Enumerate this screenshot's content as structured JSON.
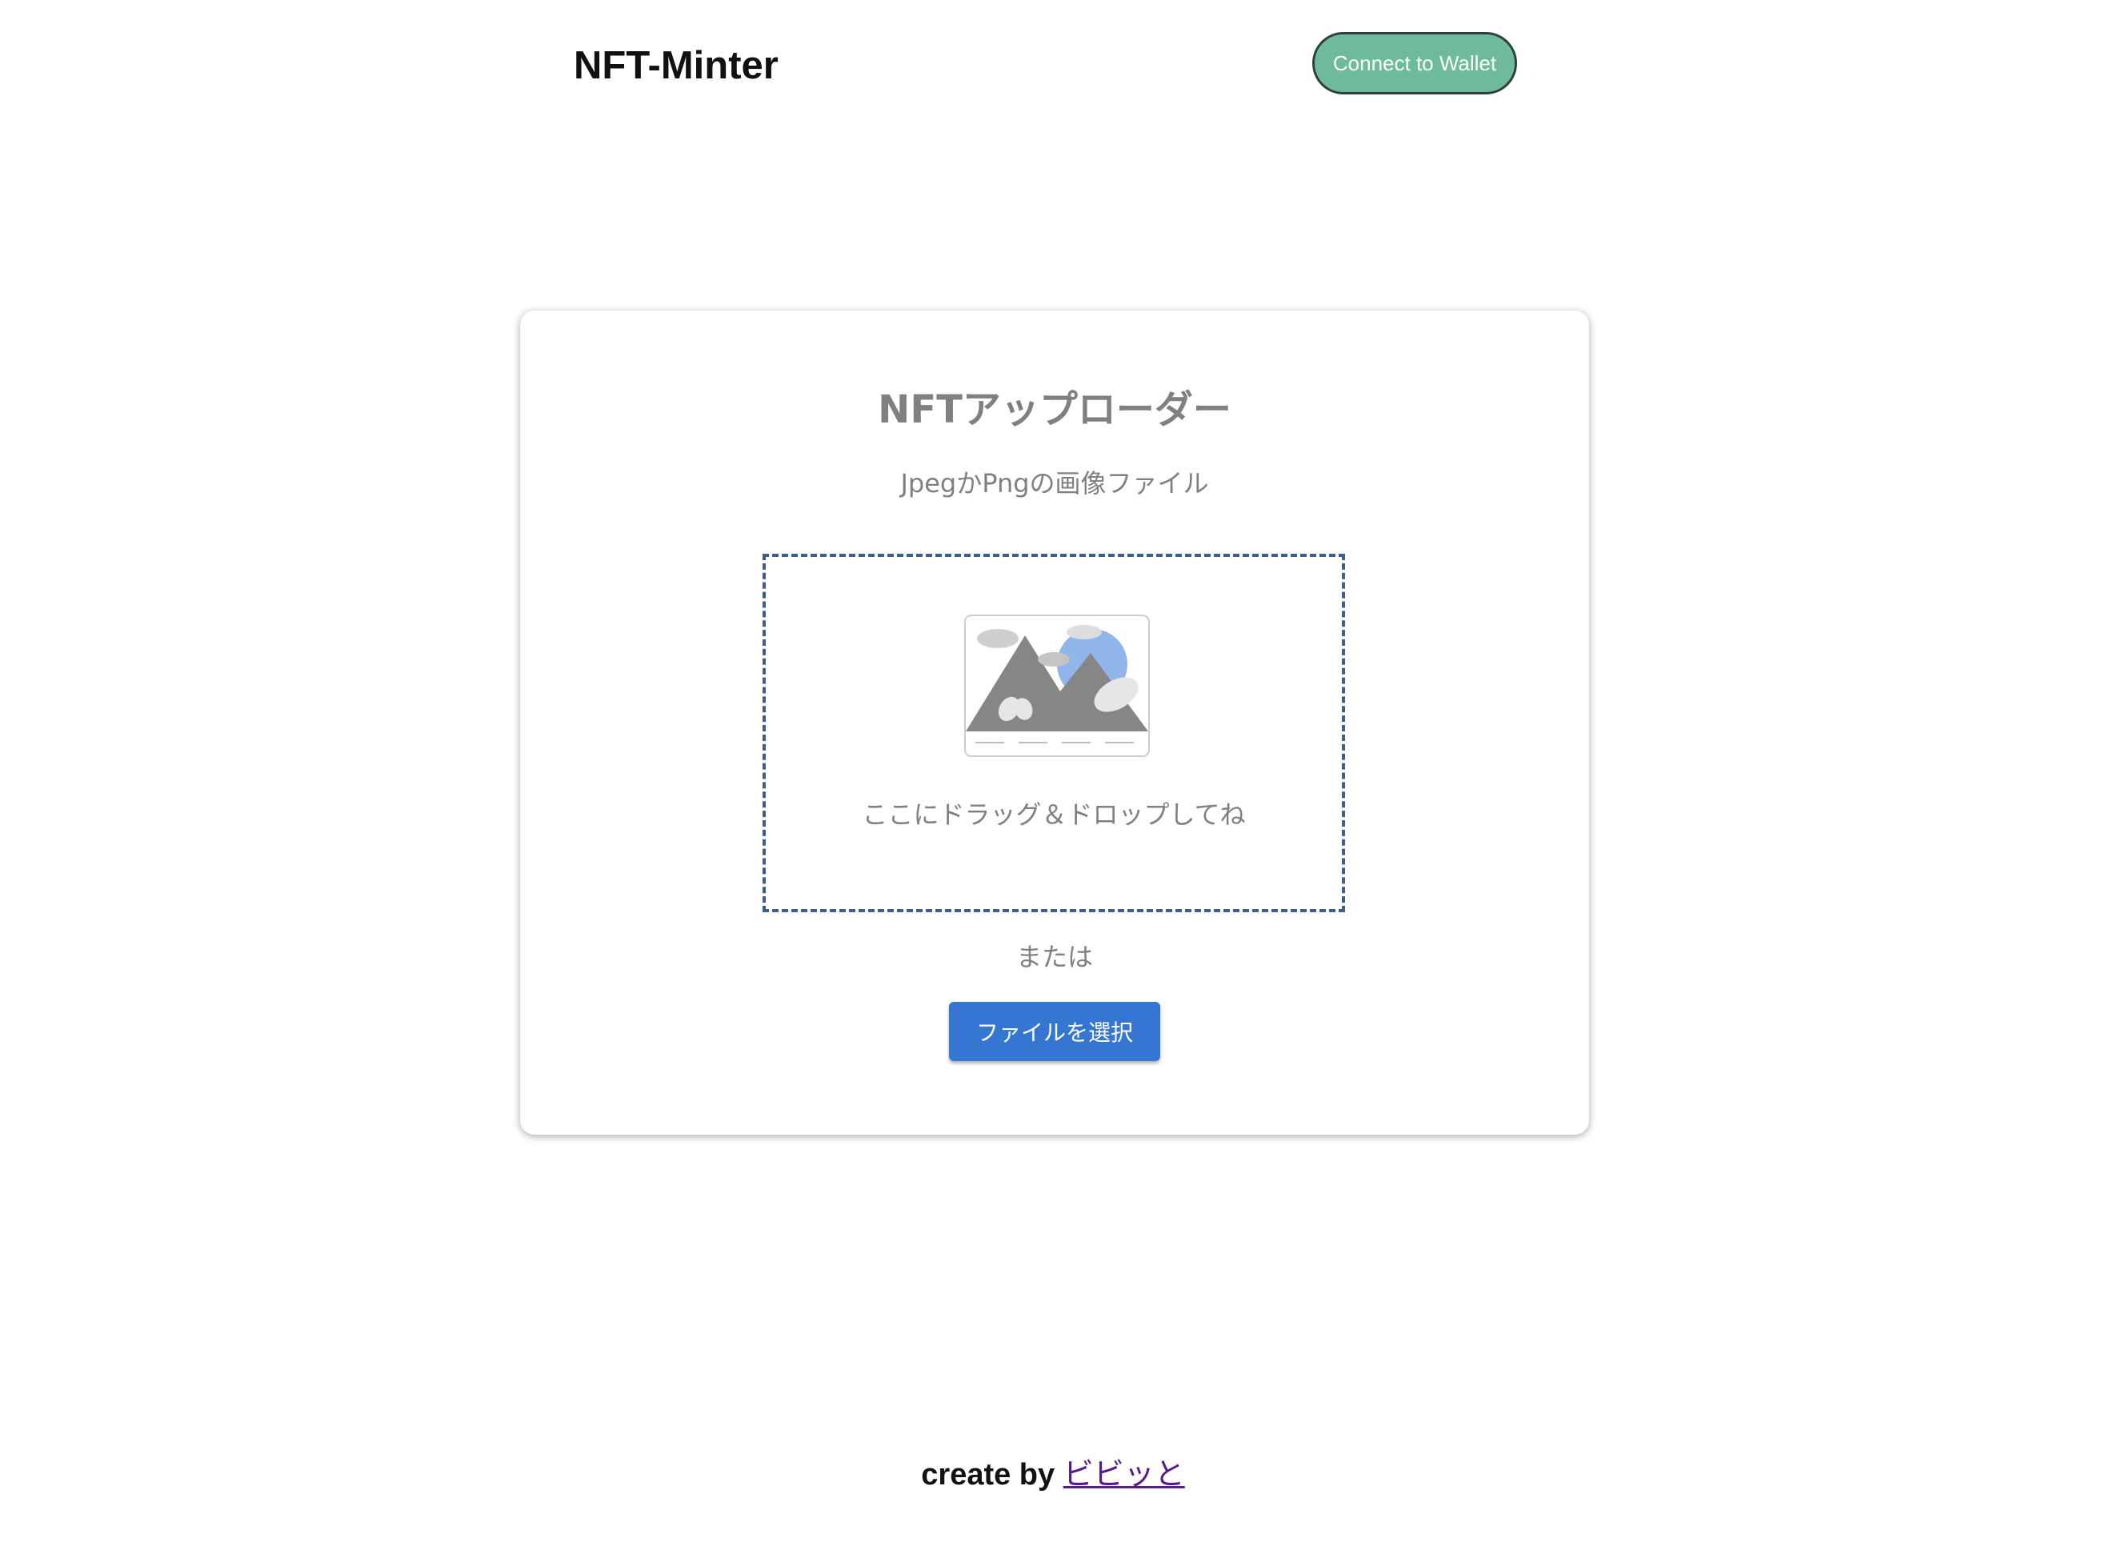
{
  "header": {
    "title": "NFT-Minter",
    "connect_label": "Connect to Wallet"
  },
  "uploader": {
    "title": "NFTアップローダー",
    "subtitle": "JpegかPngの画像ファイル",
    "drop_text": "ここにドラッグ＆ドロップしてね",
    "or_text": "または",
    "select_label": "ファイルを選択"
  },
  "footer": {
    "prefix": "create by ",
    "author_link": "ビビッと"
  },
  "colors": {
    "connect_button": "#6dbb9a",
    "select_button": "#3576d2",
    "dropzone_border": "#3d5d8c",
    "link": "#551a8b"
  }
}
